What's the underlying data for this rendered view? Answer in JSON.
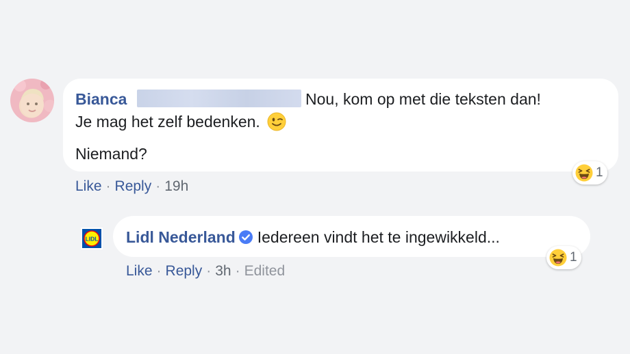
{
  "comment": {
    "author": "Bianca",
    "text_line1": "Nou, kom op met die teksten dan!",
    "text_line2": "Je mag het zelf bedenken.",
    "text_line3": "Niemand?",
    "reaction_count": "1",
    "actions": {
      "like": "Like",
      "reply": "Reply",
      "time": "19h"
    }
  },
  "reply": {
    "author": "Lidl Nederland",
    "text": "Iedereen vindt het te ingewikkeld...",
    "reaction_count": "1",
    "avatar_text": "LIDL",
    "actions": {
      "like": "Like",
      "reply": "Reply",
      "time": "3h",
      "edited": "Edited"
    }
  },
  "separator": "·",
  "icons": {
    "wink": "wink-emoji-icon",
    "haha": "haha-reaction-icon",
    "verified": "verified-badge-icon"
  },
  "colors": {
    "background": "#f2f3f5",
    "link": "#385898",
    "text": "#1c1e21",
    "muted": "#90949c",
    "verified": "#4a7cf6",
    "reaction_yellow": "#ffcf3a",
    "lidl_blue": "#0050aa",
    "lidl_yellow": "#fff000",
    "lidl_red": "#e60a14"
  }
}
